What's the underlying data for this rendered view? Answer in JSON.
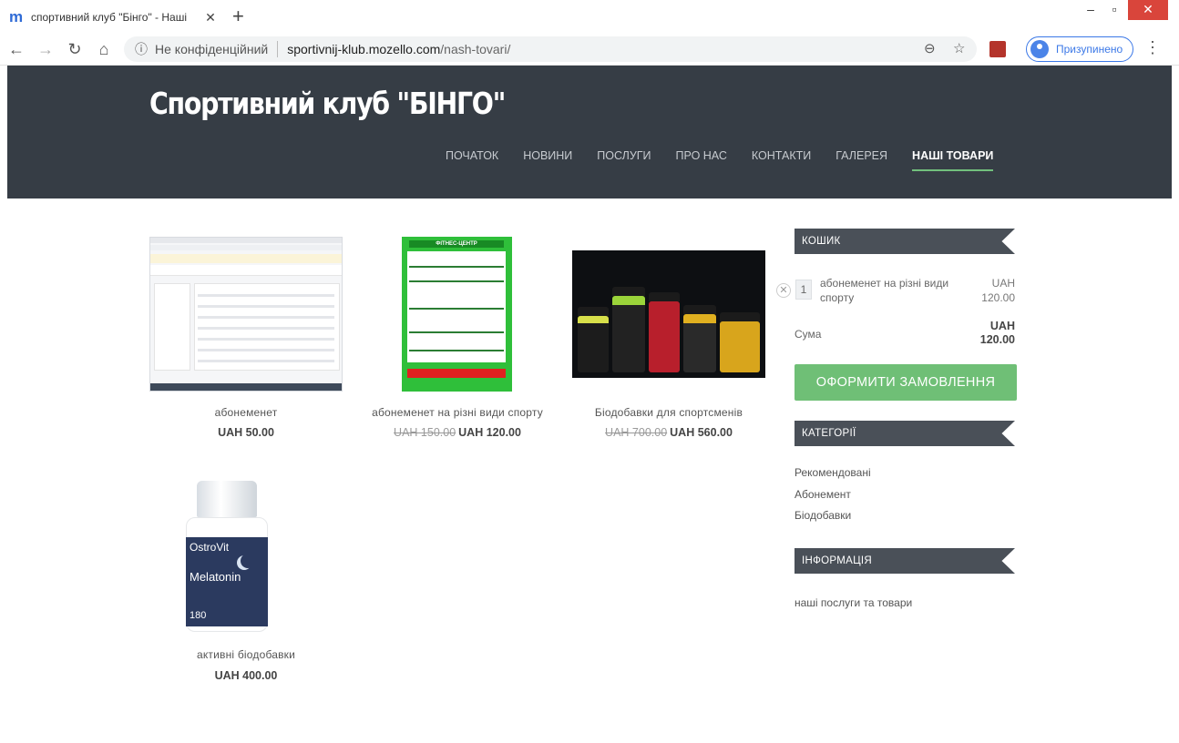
{
  "browser": {
    "tab_title": "спортивний клуб \"Бінго\" - Наші",
    "tab_favicon": "m",
    "close_tab": "✕",
    "new_tab": "+",
    "info_glyph": "ⓘ",
    "not_secure": "Не конфіденційний",
    "url_domain": "sportivnij-klub.mozello.com",
    "url_path": "/nash-tovari/",
    "profile_label": "Призупинено"
  },
  "site": {
    "title": "Спортивний клуб \"БІНГО\"",
    "nav": [
      "ПОЧАТОК",
      "НОВИНИ",
      "ПОСЛУГИ",
      "ПРО НАС",
      "КОНТАКТИ",
      "ГАЛЕРЕЯ",
      "НАШІ ТОВАРИ"
    ],
    "active_nav": "НАШІ ТОВАРИ"
  },
  "products": [
    {
      "name": "абонеменет",
      "price": "UAH 50.00",
      "old_price": ""
    },
    {
      "name": "абонеменет на різні види спорту",
      "price": "UAH 120.00",
      "old_price": "UAH 150.00"
    },
    {
      "name": "Біодобавки для спортсменів",
      "price": "UAH 560.00",
      "old_price": "UAH 700.00"
    },
    {
      "name": "активні біодобавки",
      "price": "UAH 400.00",
      "old_price": ""
    }
  ],
  "thumbs": {
    "poster_title": "ФІТНЕС-ЦЕНТР",
    "bottle_brand": "OstroVit",
    "bottle_name": "Melatonin",
    "bottle_count": "180"
  },
  "sidebar": {
    "cart_title": "КОШИК",
    "cart_item": {
      "qty": "1",
      "name": "абонеменет на різні види спорту",
      "currency": "UAH",
      "amount": "120.00"
    },
    "sum_label": "Сума",
    "sum_currency": "UAH",
    "sum_amount": "120.00",
    "order_button": "ОФОРМИТИ ЗАМОВЛЕННЯ",
    "categories_title": "КАТЕГОРІЇ",
    "categories": [
      "Рекомендовані",
      "Абонемент",
      "Біодобавки"
    ],
    "info_title": "ІНФОРМАЦІЯ",
    "info_link": "наші послуги та товари"
  },
  "colors": {
    "header_bg": "#363d45",
    "accent_green": "#6fbf76",
    "panel_head": "#4a5058"
  }
}
